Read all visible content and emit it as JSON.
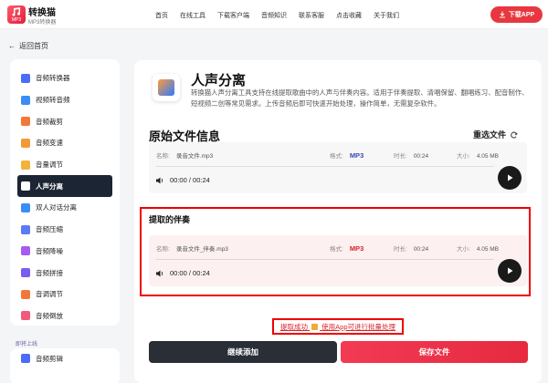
{
  "header": {
    "brand_name": "转换猫",
    "brand_sub": "MP3转换器",
    "logo_badge": "MP3",
    "nav": [
      "首页",
      "在线工具",
      "下载客户端",
      "音频知识",
      "联系客服",
      "点击收藏",
      "关于我们"
    ],
    "download_label": "下载APP",
    "accent": "#e8373f"
  },
  "back_label": "返回首页",
  "sidebar": {
    "items": [
      {
        "label": "音频转换器",
        "icon": "audio-converter-icon",
        "color": "#4a6cf7"
      },
      {
        "label": "视频转音频",
        "icon": "video-to-audio-icon",
        "color": "#3a8df5"
      },
      {
        "label": "音频裁剪",
        "icon": "audio-cut-icon",
        "color": "#f2783a"
      },
      {
        "label": "音频变速",
        "icon": "audio-speed-icon",
        "color": "#f29a3a"
      },
      {
        "label": "音量调节",
        "icon": "volume-adjust-icon",
        "color": "#f2b33a"
      },
      {
        "label": "人声分离",
        "icon": "vocal-separate-icon",
        "color": "#ffffff",
        "active": true
      },
      {
        "label": "双人对话分离",
        "icon": "dialogue-separate-icon",
        "color": "#3a8df5"
      },
      {
        "label": "音频压缩",
        "icon": "audio-compress-icon",
        "color": "#5a7bf5"
      },
      {
        "label": "音频降噪",
        "icon": "noise-reduce-icon",
        "color": "#a65cf2"
      },
      {
        "label": "音频拼接",
        "icon": "audio-join-icon",
        "color": "#7a5cf2"
      },
      {
        "label": "音调调节",
        "icon": "pitch-adjust-icon",
        "color": "#f2783a"
      },
      {
        "label": "音频倒放",
        "icon": "audio-reverse-icon",
        "color": "#f25a7a"
      }
    ],
    "section_label": "即将上线",
    "upcoming": [
      {
        "label": "音频剪辑",
        "icon": "audio-edit-icon",
        "color": "#4a6cf7"
      }
    ]
  },
  "tool": {
    "icon": "vocal-separate-app-icon",
    "title": "人声分离",
    "description": "转换猫人声分离工具支持在线提取歌曲中的人声与伴奏内容。适用于伴奏提取、清唱保留、翻唱练习、配音制作、短视频二创等常见需求。上传音频后即可快速开始处理，操作简单，无需复杂软件。"
  },
  "original": {
    "section_title": "原始文件信息",
    "reselect_label": "重选文件",
    "file": {
      "name_key": "名称:",
      "name": "录音文件.mp3",
      "format_key": "格式:",
      "format": "MP3",
      "duration_key": "时长:",
      "duration": "00:24",
      "size_key": "大小:",
      "size": "4.05 MB",
      "time_display": "00:00 / 00:24"
    }
  },
  "accompaniment": {
    "section_title": "提取的伴奏",
    "file": {
      "name_key": "名称:",
      "name": "录音文件_伴奏.mp3",
      "format_key": "格式:",
      "format": "MP3",
      "duration_key": "时长:",
      "duration": "00:24",
      "size_key": "大小:",
      "size": "4.05 MB",
      "time_display": "00:00 / 00:24"
    }
  },
  "success": {
    "text_before": "提取成功",
    "text_after": "使用App可进行批量处理"
  },
  "actions": {
    "continue_label": "继续添加",
    "save_label": "保存文件"
  }
}
